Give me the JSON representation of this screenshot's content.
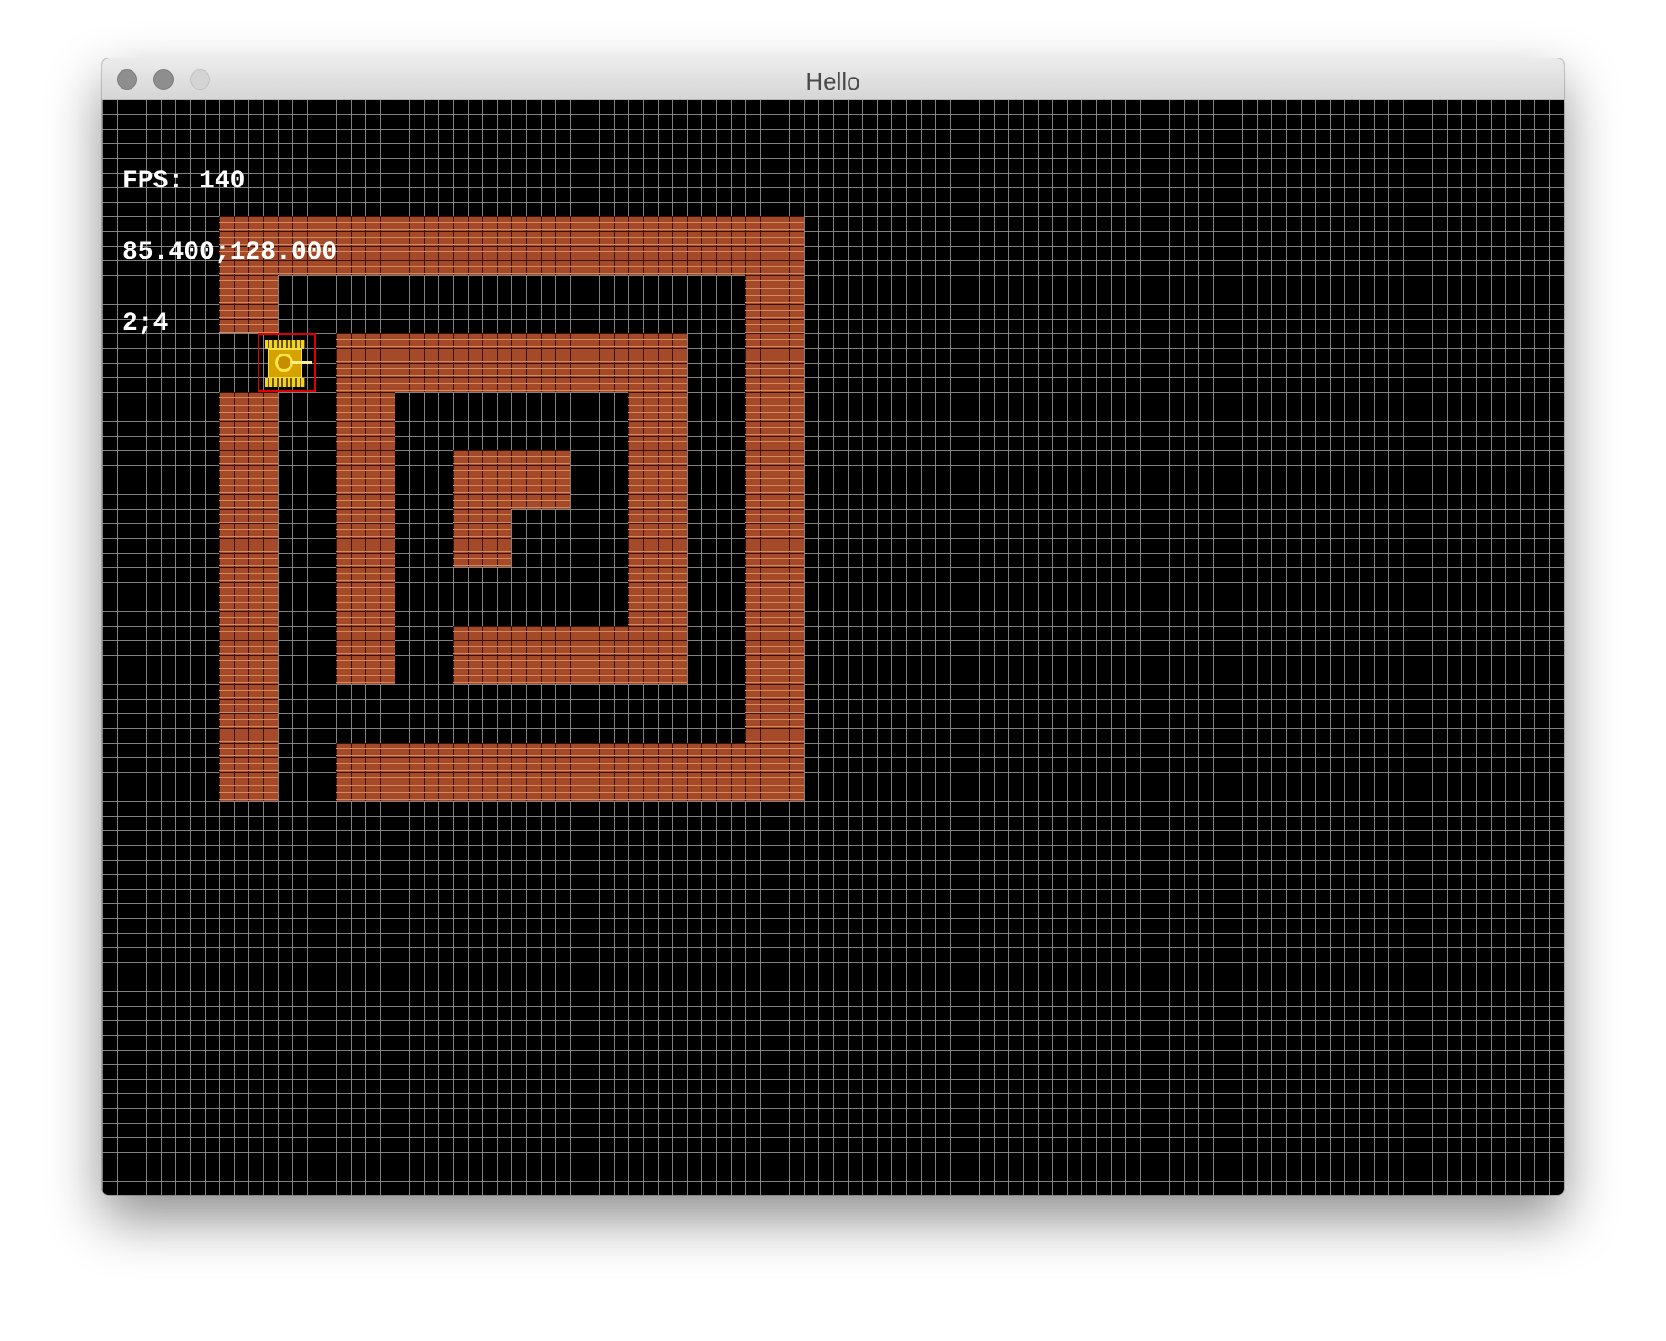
{
  "window": {
    "title": "Hello",
    "controls": [
      "close",
      "minimize",
      "zoom"
    ]
  },
  "hud": {
    "fps": "FPS: 140",
    "position": "85.400;128.000",
    "cell": "2;4"
  },
  "level": {
    "tile_size": 16,
    "brick_tile_units": 4,
    "grid_color": "#969696",
    "brick_color": "#a44a28",
    "mortar_color": "#3a1206",
    "brick_cells": [
      [
        0,
        0
      ],
      [
        1,
        0
      ],
      [
        2,
        0
      ],
      [
        3,
        0
      ],
      [
        4,
        0
      ],
      [
        5,
        0
      ],
      [
        6,
        0
      ],
      [
        7,
        0
      ],
      [
        8,
        0
      ],
      [
        9,
        0
      ],
      [
        0,
        1
      ],
      [
        9,
        1
      ],
      [
        2,
        2
      ],
      [
        3,
        2
      ],
      [
        4,
        2
      ],
      [
        5,
        2
      ],
      [
        6,
        2
      ],
      [
        7,
        2
      ],
      [
        9,
        2
      ],
      [
        0,
        3
      ],
      [
        2,
        3
      ],
      [
        7,
        3
      ],
      [
        9,
        3
      ],
      [
        0,
        4
      ],
      [
        2,
        4
      ],
      [
        4,
        4
      ],
      [
        5,
        4
      ],
      [
        7,
        4
      ],
      [
        9,
        4
      ],
      [
        0,
        5
      ],
      [
        2,
        5
      ],
      [
        4,
        5
      ],
      [
        7,
        5
      ],
      [
        9,
        5
      ],
      [
        0,
        6
      ],
      [
        2,
        6
      ],
      [
        7,
        6
      ],
      [
        9,
        6
      ],
      [
        0,
        7
      ],
      [
        2,
        7
      ],
      [
        4,
        7
      ],
      [
        5,
        7
      ],
      [
        6,
        7
      ],
      [
        7,
        7
      ],
      [
        9,
        7
      ],
      [
        0,
        8
      ],
      [
        9,
        8
      ],
      [
        0,
        9
      ],
      [
        2,
        9
      ],
      [
        3,
        9
      ],
      [
        4,
        9
      ],
      [
        5,
        9
      ],
      [
        6,
        9
      ],
      [
        7,
        9
      ],
      [
        8,
        9
      ],
      [
        9,
        9
      ]
    ]
  },
  "player": {
    "name": "player-tank",
    "color": "#d5a200",
    "highlight_color": "#e00000",
    "facing": "right"
  }
}
